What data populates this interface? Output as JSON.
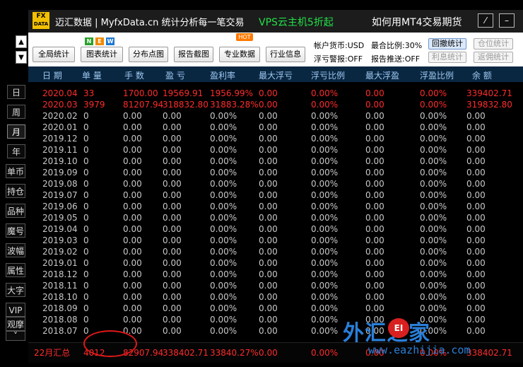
{
  "rail": {
    "top_up": "▲",
    "top_down": "▼",
    "items": [
      "日",
      "周",
      "月",
      "年",
      "单币",
      "持仓",
      "品种",
      "魔号",
      "波幅",
      "属性",
      "大字",
      "VIP",
      "观摩"
    ],
    "active": "月",
    "bottom_arrow": "˅"
  },
  "title_bar": {
    "logo_top": "FX",
    "logo_bottom": "DATA",
    "title": "迈汇数据 | MyfxData.cn  统计分析每一笔交易",
    "promo_vps": "VPS云主机5折起",
    "promo_mt4": "如何用MT4交易期货",
    "btn_edit": "⁄",
    "btn_min": "–",
    "accent_green": "#22e048"
  },
  "toolbar": {
    "buttons": [
      "全局统计",
      "图表统计",
      "分布点图",
      "报告截图",
      "专业数据",
      "行业信息"
    ],
    "new_badge": [
      "N",
      "E",
      "W"
    ],
    "hot_badge": "HOT",
    "account_currency": "帐户货币:USD",
    "max_ratio": "最合比例:30%",
    "float_alert": "浮亏警报:OFF",
    "report_push": "报告推送:OFF",
    "btn_drawdown": "回撤统计",
    "btn_position": "仓位统计",
    "btn_interest": "利息统计",
    "btn_rebate": "返佣统计"
  },
  "table": {
    "headers": [
      "日 期",
      "单 量",
      "手 数",
      "盈 亏",
      "盈利率",
      "最大浮亏",
      "浮亏比例",
      "最大浮盈",
      "浮盈比例",
      "余 额"
    ],
    "rows": [
      {
        "red": true,
        "cells": [
          "2020.04",
          "33",
          "1700.00",
          "19569.91",
          "1956.99%",
          "0.00",
          "0.00%",
          "0.00",
          "0.00%",
          "339402.71"
        ]
      },
      {
        "red": true,
        "cells": [
          "2020.03",
          "3979",
          "81207.94",
          "318832.80",
          "31883.28%",
          "0.00",
          "0.00%",
          "0.00",
          "0.00%",
          "319832.80"
        ]
      },
      {
        "red": false,
        "cells": [
          "2020.02",
          "0",
          "0.00",
          "0.00",
          "0.00%",
          "0.00",
          "0.00%",
          "0.00",
          "0.00%",
          "0.00"
        ]
      },
      {
        "red": false,
        "cells": [
          "2020.01",
          "0",
          "0.00",
          "0.00",
          "0.00%",
          "0.00",
          "0.00%",
          "0.00",
          "0.00%",
          "0.00"
        ]
      },
      {
        "red": false,
        "cells": [
          "2019.12",
          "0",
          "0.00",
          "0.00",
          "0.00%",
          "0.00",
          "0.00%",
          "0.00",
          "0.00%",
          "0.00"
        ]
      },
      {
        "red": false,
        "cells": [
          "2019.11",
          "0",
          "0.00",
          "0.00",
          "0.00%",
          "0.00",
          "0.00%",
          "0.00",
          "0.00%",
          "0.00"
        ]
      },
      {
        "red": false,
        "cells": [
          "2019.10",
          "0",
          "0.00",
          "0.00",
          "0.00%",
          "0.00",
          "0.00%",
          "0.00",
          "0.00%",
          "0.00"
        ]
      },
      {
        "red": false,
        "cells": [
          "2019.09",
          "0",
          "0.00",
          "0.00",
          "0.00%",
          "0.00",
          "0.00%",
          "0.00",
          "0.00%",
          "0.00"
        ]
      },
      {
        "red": false,
        "cells": [
          "2019.08",
          "0",
          "0.00",
          "0.00",
          "0.00%",
          "0.00",
          "0.00%",
          "0.00",
          "0.00%",
          "0.00"
        ]
      },
      {
        "red": false,
        "cells": [
          "2019.07",
          "0",
          "0.00",
          "0.00",
          "0.00%",
          "0.00",
          "0.00%",
          "0.00",
          "0.00%",
          "0.00"
        ]
      },
      {
        "red": false,
        "cells": [
          "2019.06",
          "0",
          "0.00",
          "0.00",
          "0.00%",
          "0.00",
          "0.00%",
          "0.00",
          "0.00%",
          "0.00"
        ]
      },
      {
        "red": false,
        "cells": [
          "2019.05",
          "0",
          "0.00",
          "0.00",
          "0.00%",
          "0.00",
          "0.00%",
          "0.00",
          "0.00%",
          "0.00"
        ]
      },
      {
        "red": false,
        "cells": [
          "2019.04",
          "0",
          "0.00",
          "0.00",
          "0.00%",
          "0.00",
          "0.00%",
          "0.00",
          "0.00%",
          "0.00"
        ]
      },
      {
        "red": false,
        "cells": [
          "2019.03",
          "0",
          "0.00",
          "0.00",
          "0.00%",
          "0.00",
          "0.00%",
          "0.00",
          "0.00%",
          "0.00"
        ]
      },
      {
        "red": false,
        "cells": [
          "2019.02",
          "0",
          "0.00",
          "0.00",
          "0.00%",
          "0.00",
          "0.00%",
          "0.00",
          "0.00%",
          "0.00"
        ]
      },
      {
        "red": false,
        "cells": [
          "2019.01",
          "0",
          "0.00",
          "0.00",
          "0.00%",
          "0.00",
          "0.00%",
          "0.00",
          "0.00%",
          "0.00"
        ]
      },
      {
        "red": false,
        "cells": [
          "2018.12",
          "0",
          "0.00",
          "0.00",
          "0.00%",
          "0.00",
          "0.00%",
          "0.00",
          "0.00%",
          "0.00"
        ]
      },
      {
        "red": false,
        "cells": [
          "2018.11",
          "0",
          "0.00",
          "0.00",
          "0.00%",
          "0.00",
          "0.00%",
          "0.00",
          "0.00%",
          "0.00"
        ]
      },
      {
        "red": false,
        "cells": [
          "2018.10",
          "0",
          "0.00",
          "0.00",
          "0.00%",
          "0.00",
          "0.00%",
          "0.00",
          "0.00%",
          "0.00"
        ]
      },
      {
        "red": false,
        "cells": [
          "2018.09",
          "0",
          "0.00",
          "0.00",
          "0.00%",
          "0.00",
          "0.00%",
          "0.00",
          "0.00%",
          "0.00"
        ]
      },
      {
        "red": false,
        "cells": [
          "2018.08",
          "0",
          "0.00",
          "0.00",
          "0.00%",
          "0.00",
          "0.00%",
          "0.00",
          "0.00%",
          "0.00"
        ]
      },
      {
        "red": false,
        "cells": [
          "2018.07",
          "0",
          "0.00",
          "0.00",
          "0.00%",
          "0.00",
          "0.00%",
          "0.00",
          "0.00%",
          "0.00"
        ]
      }
    ],
    "footer": [
      "22月汇总",
      "4012",
      "82907.94",
      "338402.71",
      "33840.27%",
      "0.00",
      "0.00%",
      "0.00",
      "0.00%",
      "338402.71"
    ],
    "red_color": "#ff2b2b",
    "header_color": "#9ec9f0"
  },
  "watermark": {
    "brand": "外汇之家",
    "ei": "EI",
    "url": "www.eazhijia.com"
  }
}
